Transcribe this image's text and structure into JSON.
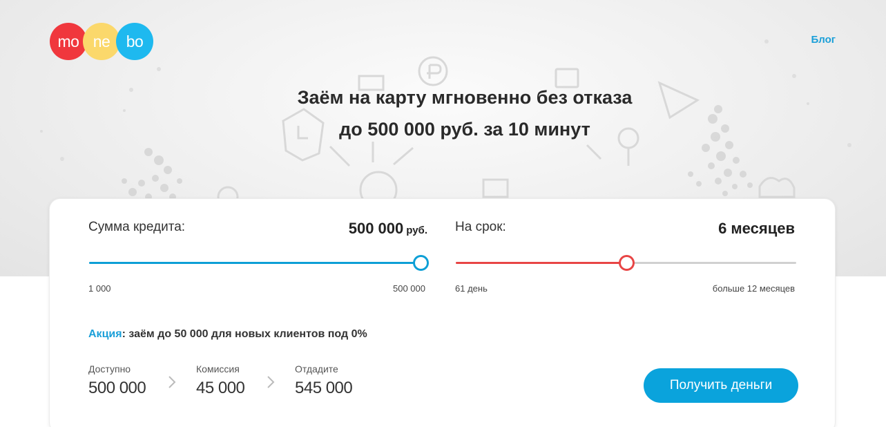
{
  "logo": {
    "syllables": [
      "mo",
      "ne",
      "bo"
    ]
  },
  "nav": {
    "blog_label": "Блог"
  },
  "hero": {
    "title_line1": "Заём на карту мгновенно без отказа",
    "title_line2": "до 500 000 руб. за 10 минут"
  },
  "amount": {
    "label": "Сумма кредита:",
    "value": "500 000",
    "unit": "руб.",
    "min_label": "1 000",
    "max_label": "500 000",
    "level": 1.0
  },
  "term": {
    "label": "На срок:",
    "value": "6 месяцев",
    "min_label": "61 день",
    "max_label": "больше 12 месяцев",
    "level": 0.5
  },
  "promo": {
    "accent": "Акция",
    "text": ": заём до 50 000 для новых клиентов под 0%"
  },
  "summary": {
    "available_label": "Доступно",
    "available_value": "500 000",
    "commission_label": "Комиссия",
    "commission_value": "45 000",
    "repay_label": "Отдадите",
    "repay_value": "545 000"
  },
  "cta": {
    "label": "Получить деньги"
  },
  "colors": {
    "accent_blue": "#1a9fd8",
    "amount_slider": "#0d9fd6",
    "term_slider": "#e84545",
    "logo_red": "#f0373d",
    "logo_yellow": "#fbd86b",
    "logo_blue": "#1eb9ef",
    "button": "#0aa3dc"
  }
}
